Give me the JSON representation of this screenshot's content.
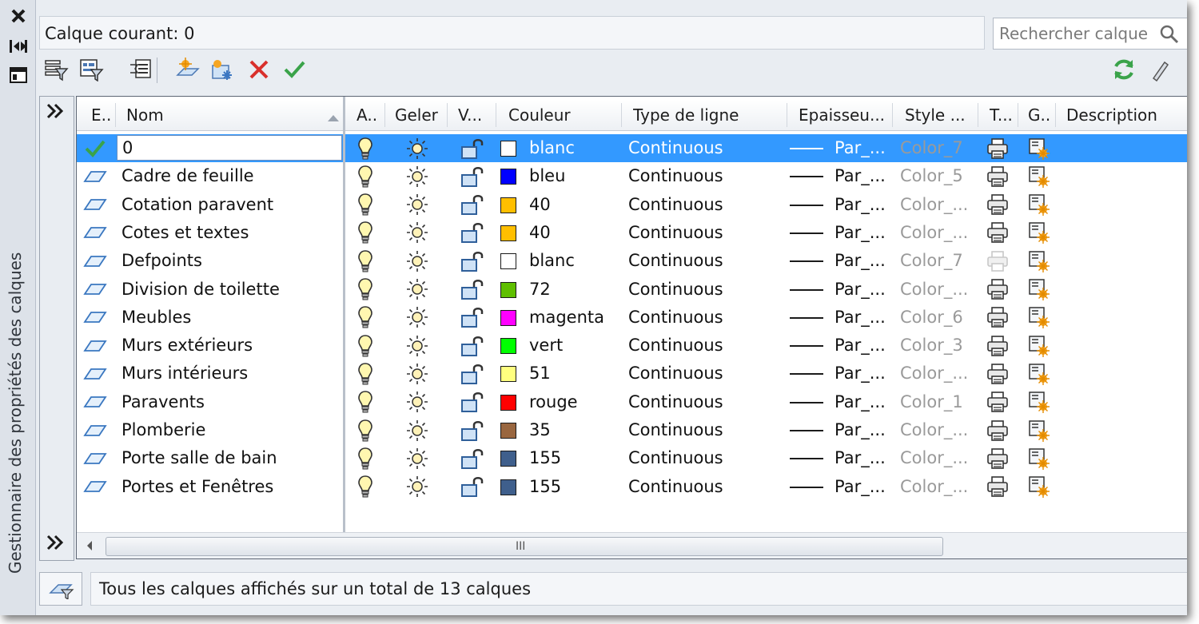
{
  "sidebar": {
    "title": "Gestionnaire des propriétés des calques"
  },
  "current_layer_label": "Calque courant: 0",
  "search": {
    "placeholder": "Rechercher calque"
  },
  "toolbar": {
    "buttons": [
      "new-property-filter",
      "new-group-filter",
      "layer-states-manager",
      "new-layer",
      "new-layer-vp-frozen",
      "delete-layer",
      "set-current"
    ]
  },
  "columns": {
    "status": "E..",
    "name": "Nom",
    "on": "A..",
    "freeze": "Geler",
    "lock": "V...",
    "color": "Couleur",
    "linetype": "Type de ligne",
    "lineweight": "Epaisseu...",
    "plotstyle": "Style ...",
    "plot": "T...",
    "newvp": "G..",
    "description": "Description"
  },
  "layers": [
    {
      "name": "0",
      "color": "blanc",
      "hex": "#ffffff",
      "linetype": "Continuous",
      "lineweight": "Par_...",
      "style": "Color_7",
      "plot": true
    },
    {
      "name": "Cadre de feuille",
      "color": "bleu",
      "hex": "#0000ff",
      "linetype": "Continuous",
      "lineweight": "Par_...",
      "style": "Color_5",
      "plot": true
    },
    {
      "name": "Cotation paravent",
      "color": "40",
      "hex": "#ffbf00",
      "linetype": "Continuous",
      "lineweight": "Par_...",
      "style": "Color_...",
      "plot": true
    },
    {
      "name": "Cotes et textes",
      "color": "40",
      "hex": "#ffbf00",
      "linetype": "Continuous",
      "lineweight": "Par_...",
      "style": "Color_...",
      "plot": true
    },
    {
      "name": "Defpoints",
      "color": "blanc",
      "hex": "#ffffff",
      "linetype": "Continuous",
      "lineweight": "Par_...",
      "style": "Color_7",
      "plot": false
    },
    {
      "name": "Division de toilette",
      "color": "72",
      "hex": "#5fbf00",
      "linetype": "Continuous",
      "lineweight": "Par_...",
      "style": "Color_...",
      "plot": true
    },
    {
      "name": "Meubles",
      "color": "magenta",
      "hex": "#ff00ff",
      "linetype": "Continuous",
      "lineweight": "Par_...",
      "style": "Color_6",
      "plot": true
    },
    {
      "name": "Murs extérieurs",
      "color": "vert",
      "hex": "#00ff00",
      "linetype": "Continuous",
      "lineweight": "Par_...",
      "style": "Color_3",
      "plot": true
    },
    {
      "name": "Murs intérieurs",
      "color": "51",
      "hex": "#ffff7f",
      "linetype": "Continuous",
      "lineweight": "Par_...",
      "style": "Color_...",
      "plot": true
    },
    {
      "name": "Paravents",
      "color": "rouge",
      "hex": "#ff0000",
      "linetype": "Continuous",
      "lineweight": "Par_...",
      "style": "Color_1",
      "plot": true
    },
    {
      "name": "Plomberie",
      "color": "35",
      "hex": "#99663f",
      "linetype": "Continuous",
      "lineweight": "Par_...",
      "style": "Color_...",
      "plot": true
    },
    {
      "name": "Porte salle de bain",
      "color": "155",
      "hex": "#3f5f8c",
      "linetype": "Continuous",
      "lineweight": "Par_...",
      "style": "Color_...",
      "plot": true
    },
    {
      "name": "Portes et Fenêtres",
      "color": "155",
      "hex": "#3f5f8c",
      "linetype": "Continuous",
      "lineweight": "Par_...",
      "style": "Color_...",
      "plot": true
    }
  ],
  "status_text": "Tous les calques affichés sur un total de 13 calques",
  "colors": {
    "selection": "#3399ff",
    "accent_check": "#3aa34a",
    "delete_red": "#d9302c"
  }
}
